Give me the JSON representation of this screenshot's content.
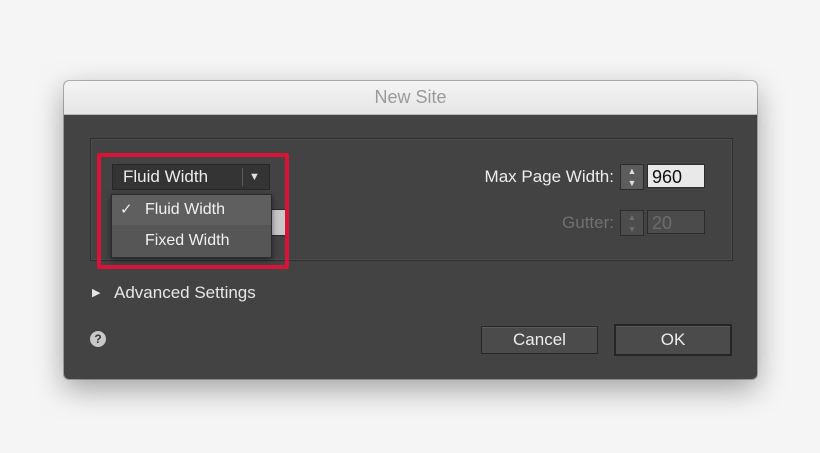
{
  "dialog": {
    "title": "New Site"
  },
  "layout_select": {
    "value": "Fluid Width",
    "options": [
      {
        "label": "Fluid Width",
        "selected": true
      },
      {
        "label": "Fixed Width",
        "selected": false
      }
    ]
  },
  "max_page_width": {
    "label": "Max Page Width:",
    "value": "960"
  },
  "gutter": {
    "label": "Gutter:",
    "value": "20",
    "disabled": true
  },
  "advanced": {
    "label": "Advanced Settings"
  },
  "help": {
    "glyph": "?"
  },
  "buttons": {
    "cancel": "Cancel",
    "ok": "OK"
  },
  "glyphs": {
    "check": "✓",
    "dropdown_arrow": "▼",
    "step_up": "▲",
    "step_down": "▼",
    "disclosure": "▶"
  },
  "colors": {
    "highlight": "#d91337",
    "dialog_bg": "#434343"
  }
}
